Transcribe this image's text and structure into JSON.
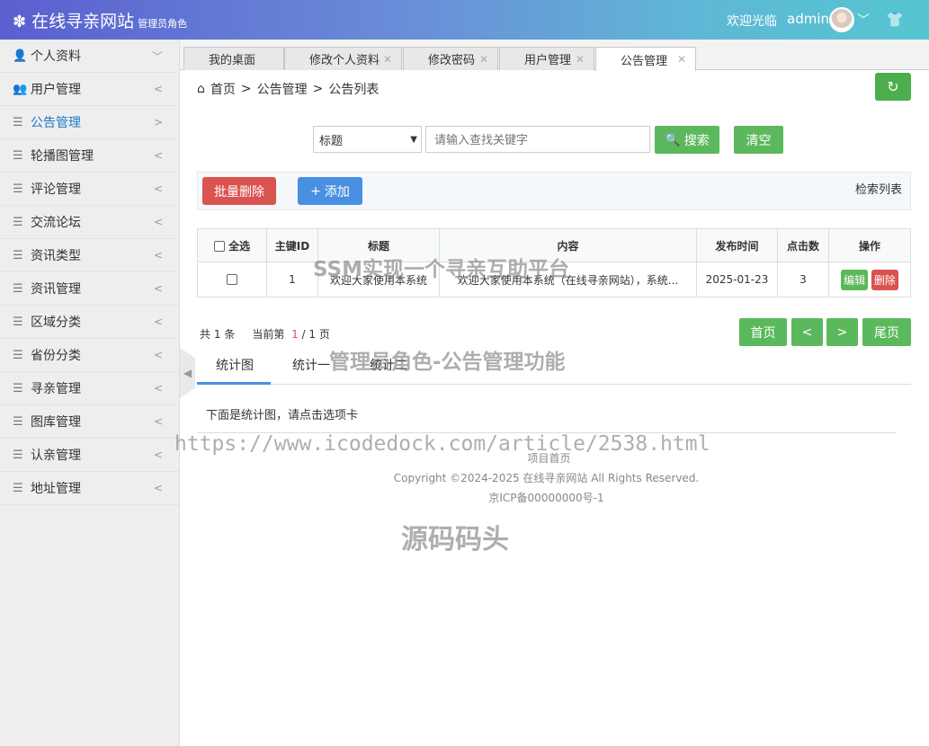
{
  "header": {
    "logo_icon": "gear-icon",
    "title": "在线寻亲网站",
    "subtitle": "管理员角色",
    "welcome": "欢迎光临",
    "username": "admin"
  },
  "sidebar": {
    "items": [
      {
        "label": "个人资料",
        "icon": "user-icon",
        "arrow": "﹀"
      },
      {
        "label": "用户管理",
        "icon": "users-icon",
        "arrow": "<"
      },
      {
        "label": "公告管理",
        "icon": "list-icon",
        "arrow": ">"
      },
      {
        "label": "轮播图管理",
        "icon": "list-icon",
        "arrow": "<"
      },
      {
        "label": "评论管理",
        "icon": "list-icon",
        "arrow": "<"
      },
      {
        "label": "交流论坛",
        "icon": "list-icon",
        "arrow": "<"
      },
      {
        "label": "资讯类型",
        "icon": "list-icon",
        "arrow": "<"
      },
      {
        "label": "资讯管理",
        "icon": "list-icon",
        "arrow": "<"
      },
      {
        "label": "区域分类",
        "icon": "list-icon",
        "arrow": "<"
      },
      {
        "label": "省份分类",
        "icon": "list-icon",
        "arrow": "<"
      },
      {
        "label": "寻亲管理",
        "icon": "list-icon",
        "arrow": "<"
      },
      {
        "label": "图库管理",
        "icon": "list-icon",
        "arrow": "<"
      },
      {
        "label": "认亲管理",
        "icon": "list-icon",
        "arrow": "<"
      },
      {
        "label": "地址管理",
        "icon": "list-icon",
        "arrow": "<"
      }
    ]
  },
  "tabs": [
    {
      "label": "我的桌面"
    },
    {
      "label": "修改个人资料"
    },
    {
      "label": "修改密码"
    },
    {
      "label": "用户管理"
    },
    {
      "label": "公告管理"
    }
  ],
  "breadcrumb": {
    "home": "首页",
    "sep": ">",
    "level1": "公告管理",
    "level2": "公告列表"
  },
  "search": {
    "field_selected": "标题",
    "placeholder": "请输入查找关键字",
    "search_label": "搜索",
    "clear_label": "清空"
  },
  "toolbar": {
    "batch_delete": "批量删除",
    "add": "添加",
    "retrieve_list": "检索列表"
  },
  "table": {
    "headers": [
      "全选",
      "主键ID",
      "标题",
      "内容",
      "发布时间",
      "点击数",
      "操作"
    ],
    "rows": [
      {
        "id": "1",
        "title": "欢迎大家使用本系统",
        "content": "欢迎大家使用本系统（在线寻亲网站），系统...",
        "date": "2025-01-23",
        "clicks": "3",
        "edit": "编辑",
        "delete": "删除"
      }
    ]
  },
  "pagination": {
    "total_prefix": "共",
    "total": "1",
    "total_suffix": "条",
    "current_prefix": "当前第",
    "current": "1",
    "pages": "/ 1 页",
    "first": "首页",
    "prev": "<",
    "next": ">",
    "last": "尾页"
  },
  "stats": {
    "tabs": [
      "统计图",
      "统计一",
      "统计二"
    ],
    "description": "下面是统计图，请点击选项卡"
  },
  "footer": {
    "home_link": "项目首页",
    "copyright": "Copyright ©2024-2025 在线寻亲网站 All Rights Reserved.",
    "icp": "京ICP备00000000号-1"
  },
  "watermarks": {
    "line1": "SSM实现一个寻亲互助平台",
    "line2": "管理员角色-公告管理功能",
    "line3": "https://www.icodedock.com/article/2538.html",
    "line4": "源码码头"
  },
  "colors": {
    "green": "#5cb85c",
    "red": "#d9534f",
    "blue": "#4a90e2",
    "active_link": "#1e79c9"
  }
}
